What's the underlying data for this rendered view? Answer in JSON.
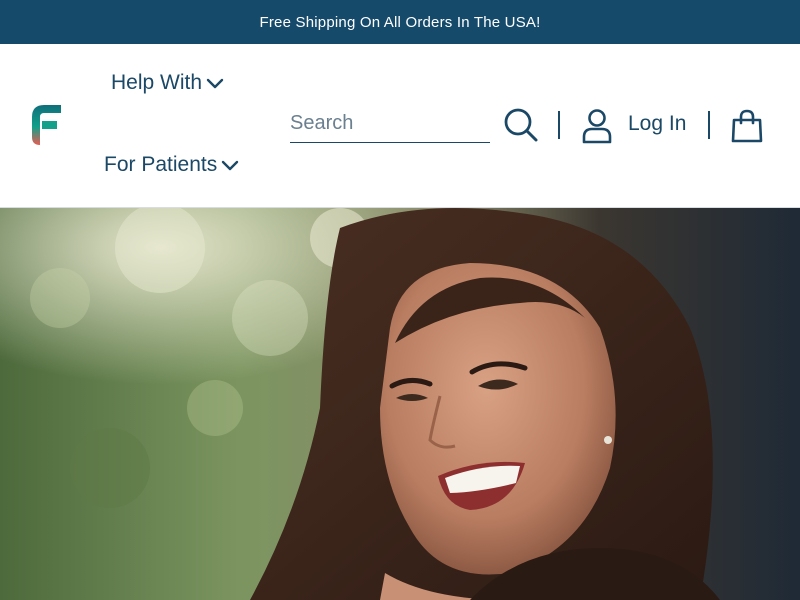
{
  "announcement": {
    "text": "Free Shipping On All Orders In The USA!"
  },
  "header": {
    "logo": "brand-f-logo",
    "nav": [
      {
        "label": "Help With",
        "icon": "chevron-down-icon"
      },
      {
        "label": "For Patients",
        "icon": "chevron-down-icon"
      }
    ],
    "search": {
      "placeholder": "Search",
      "value": "",
      "icon": "search-icon"
    },
    "account": {
      "label": "Log In",
      "icon": "user-icon"
    },
    "cart": {
      "icon": "shopping-bag-icon"
    }
  },
  "hero": {
    "image": "smiling-woman-photo"
  },
  "colors": {
    "brand_navy": "#154a6b",
    "text_navy": "#1b4866",
    "logo_teal": "#0f7f6e",
    "logo_coral": "#e05a55"
  }
}
